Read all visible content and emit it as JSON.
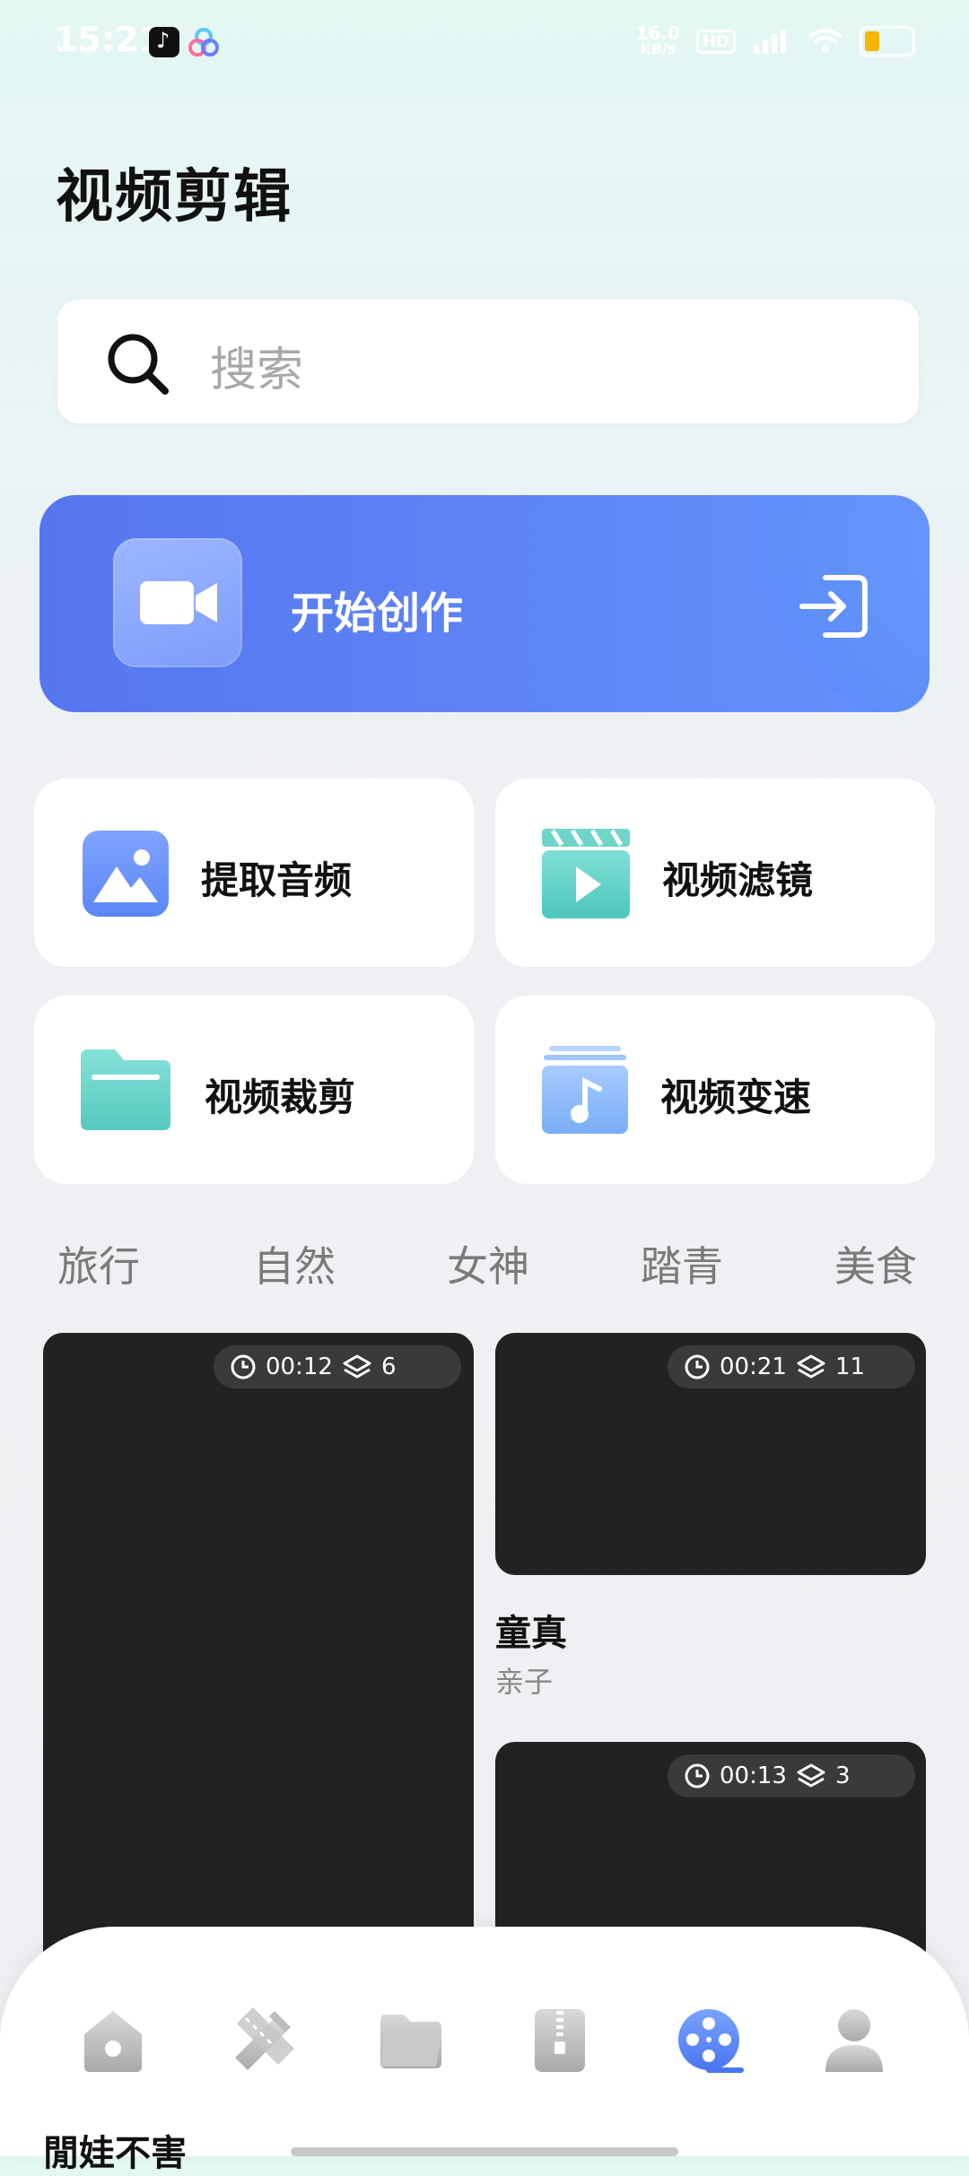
{
  "status_bar": {
    "time": "15:21",
    "net_speed_value": "16.0",
    "net_speed_unit": "KB/s",
    "hd_badge": "HD"
  },
  "page_title": "视频剪辑",
  "search": {
    "placeholder": "搜索"
  },
  "create_banner": {
    "label": "开始创作"
  },
  "tools": [
    {
      "label": "提取音频",
      "icon": "image-icon"
    },
    {
      "label": "视频滤镜",
      "icon": "play-clapper-icon"
    },
    {
      "label": "视频裁剪",
      "icon": "folder-icon"
    },
    {
      "label": "视频变速",
      "icon": "music-stack-icon"
    }
  ],
  "categories": [
    "旅行",
    "自然",
    "女神",
    "踏青",
    "美食"
  ],
  "templates": [
    {
      "duration": "00:12",
      "layers": "6",
      "title": "",
      "subtitle": ""
    },
    {
      "duration": "00:21",
      "layers": "11",
      "title": "童真",
      "subtitle": "亲子"
    },
    {
      "duration": "00:13",
      "layers": "3",
      "title": "",
      "subtitle": ""
    }
  ],
  "partial_title": "閒娃不害",
  "bottom_nav": [
    {
      "name": "home",
      "icon": "home-icon",
      "active": false
    },
    {
      "name": "edit",
      "icon": "pencil-ruler-icon",
      "active": false
    },
    {
      "name": "files",
      "icon": "folder-icon",
      "active": false
    },
    {
      "name": "archive",
      "icon": "zip-icon",
      "active": false
    },
    {
      "name": "video",
      "icon": "film-reel-icon",
      "active": true
    },
    {
      "name": "profile",
      "icon": "user-icon",
      "active": false
    }
  ],
  "colors": {
    "accent": "#5b86f6",
    "card": "#ffffff",
    "thumb": "#222222"
  }
}
